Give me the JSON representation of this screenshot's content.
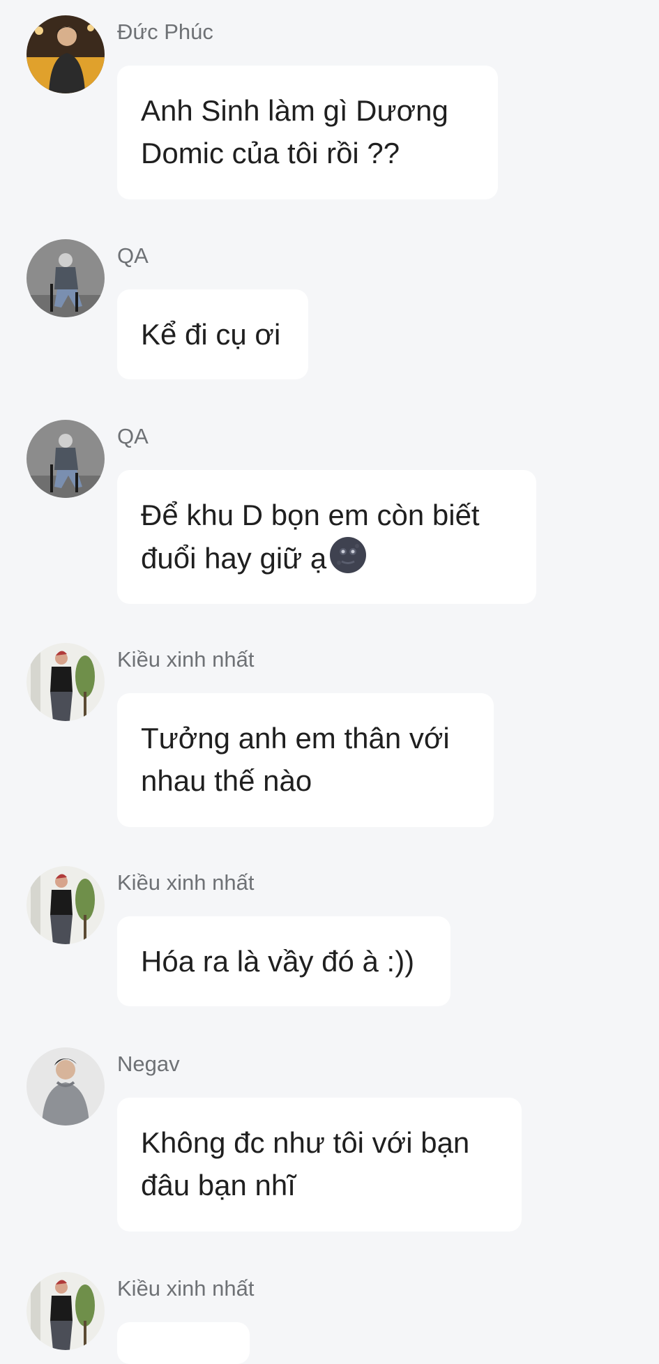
{
  "messages": [
    {
      "sender": "Đức Phúc",
      "avatar": "avatar-duc-phuc",
      "text": "Anh Sinh làm gì Dương\nDomic của tôi rồi ??"
    },
    {
      "sender": "QA",
      "avatar": "avatar-qa",
      "text": "Kể đi cụ ơi"
    },
    {
      "sender": "QA",
      "avatar": "avatar-qa",
      "text": "Để khu D bọn em còn biết\nđuổi hay giữ ạ",
      "emoji": "new-moon-face-emoji"
    },
    {
      "sender": "Kiều xinh nhất",
      "avatar": "avatar-kieu",
      "text": "Tưởng anh em thân với\nnhau thế nào"
    },
    {
      "sender": "Kiều xinh nhất",
      "avatar": "avatar-kieu",
      "text": "Hóa ra là vầy đó à :))"
    },
    {
      "sender": "Negav",
      "avatar": "avatar-negav",
      "text": "Không đc như tôi với bạn\nđâu bạn nhĩ"
    },
    {
      "sender": "Kiều xinh nhất",
      "avatar": "avatar-kieu",
      "text": ""
    }
  ],
  "colors": {
    "background": "#f5f6f8",
    "bubble": "#ffffff",
    "sender_text": "#6e7175",
    "message_text": "#1f1f1f"
  }
}
